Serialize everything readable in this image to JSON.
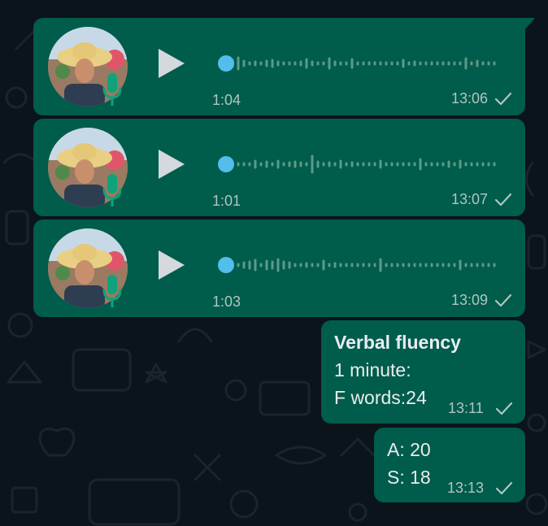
{
  "colors": {
    "background": "#0b141a",
    "outgoing_bubble": "#005c4b",
    "play_dot": "#53bdeb",
    "meta_text": "#b0c6bf"
  },
  "voice_messages": [
    {
      "duration": "1:04",
      "time": "13:06",
      "status_icon": "sent-check-icon"
    },
    {
      "duration": "1:01",
      "time": "13:07",
      "status_icon": "sent-check-icon"
    },
    {
      "duration": "1:03",
      "time": "13:09",
      "status_icon": "sent-check-icon"
    }
  ],
  "text_messages": [
    {
      "lines": [
        "Verbal fluency",
        "1 minute:",
        "F words:24"
      ],
      "time": "13:11",
      "status_icon": "sent-check-icon"
    },
    {
      "lines": [
        "A: 20",
        "S: 18"
      ],
      "time": "13:13",
      "status_icon": "sent-check-icon"
    }
  ]
}
